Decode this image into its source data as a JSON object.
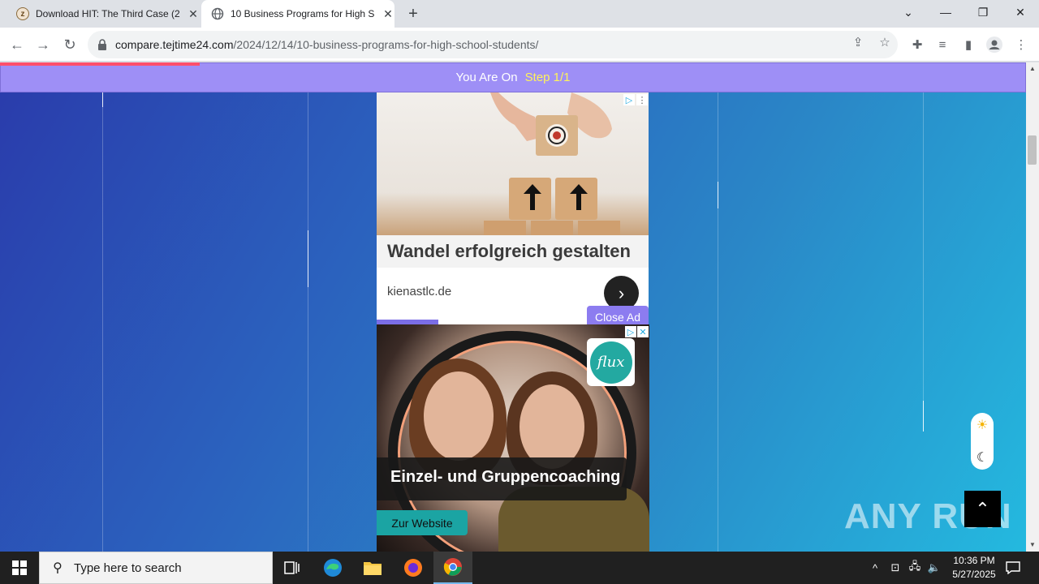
{
  "browser": {
    "tabs": [
      {
        "title": "Download HIT: The Third Case (2",
        "favicon": "z"
      },
      {
        "title": "10 Business Programs for High S",
        "favicon": "globe-icon"
      }
    ],
    "url_host": "compare.tejtime24.com",
    "url_path": "/2024/12/14/10-business-programs-for-high-school-students/"
  },
  "page": {
    "step_prefix": "You Are On",
    "step_value": "Step 1/1",
    "ad1": {
      "headline": "Wandel erfolgreich gestalten",
      "domain": "kienastlc.de"
    },
    "close_ad": "Close Ad",
    "ad2": {
      "logo_text": "flux",
      "headline": "Einzel- und Gruppencoaching",
      "cta": "Zur Website"
    },
    "watermark": "ANY RUN"
  },
  "taskbar": {
    "search_placeholder": "Type here to search",
    "time": "10:36 PM",
    "date": "5/27/2025"
  },
  "colors": {
    "step_bar": "#9e8ff6",
    "step_highlight": "#fff35a",
    "progress": "#ff4f6b",
    "cta": "#1ba4a3"
  }
}
